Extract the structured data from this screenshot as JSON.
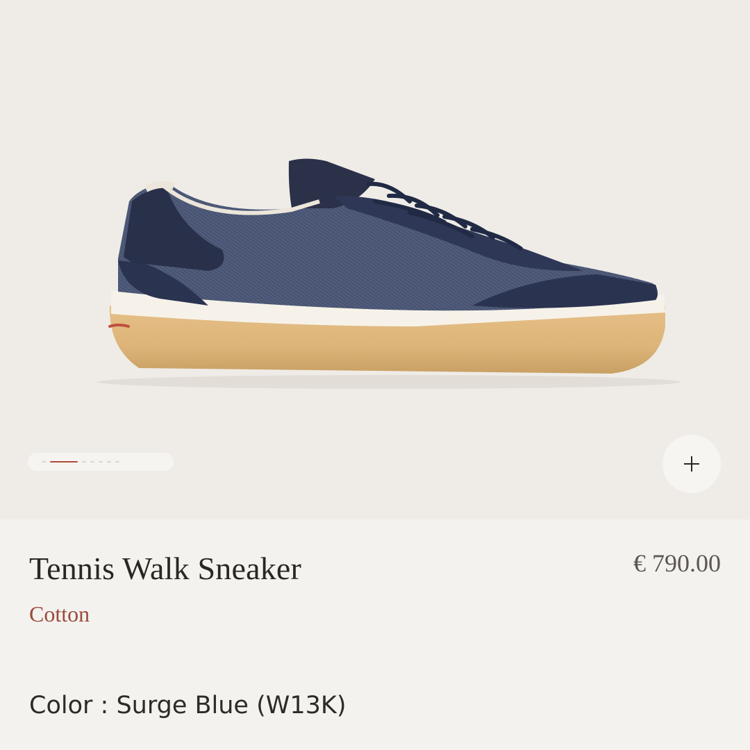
{
  "product": {
    "name": "Tennis Walk Sneaker",
    "price": "€ 790.00",
    "material": "Cotton",
    "color_label": "Color",
    "color_separator": " : ",
    "color_value": "Surge Blue (W13K)"
  },
  "gallery": {
    "image_count": 7,
    "active_index": 1,
    "zoom_symbol": "+",
    "zoom_icon": "plus-icon"
  },
  "colors": {
    "accent": "#b24a3c",
    "material_text": "#9a4a3d",
    "upper": "#4a5778",
    "suede": "#2c3550",
    "sole": "#e0b77c"
  }
}
